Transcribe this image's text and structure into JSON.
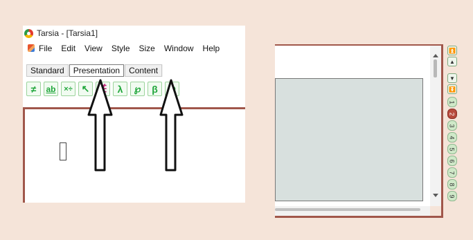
{
  "window": {
    "title": "Tarsia - [Tarsia1]"
  },
  "menu": [
    "File",
    "Edit",
    "View",
    "Style",
    "Size",
    "Window",
    "Help"
  ],
  "tabs": [
    {
      "label": "Standard",
      "active": false
    },
    {
      "label": "Presentation",
      "active": true
    },
    {
      "label": "Content",
      "active": false
    }
  ],
  "toolbar": [
    {
      "glyph": "≠",
      "icon": "not-equal-icon"
    },
    {
      "glyph": "ab",
      "icon": "text-ab-icon"
    },
    {
      "glyph": "×÷",
      "icon": "multiply-divide-icon"
    },
    {
      "glyph": "↖",
      "icon": "arrow-up-left-icon"
    },
    {
      "glyph": "∉",
      "icon": "not-element-icon"
    },
    {
      "glyph": "λ",
      "icon": "lambda-icon"
    },
    {
      "glyph": "℘",
      "icon": "weierstrass-p-icon"
    },
    {
      "glyph": "β",
      "icon": "beta-icon"
    },
    {
      "glyph": "Ω",
      "icon": "omega-icon"
    }
  ],
  "page_navigator": {
    "pages": [
      "1",
      "2",
      "3",
      "4",
      "5",
      "6",
      "7",
      "8",
      "9"
    ],
    "current_page": "2",
    "colors": {
      "current": "#b84a3c",
      "normal": "#cfe8c8"
    }
  },
  "colors": {
    "background": "#f5e4d9",
    "frame": "#a0564a",
    "toolbar_icon": "#1fa63a"
  }
}
